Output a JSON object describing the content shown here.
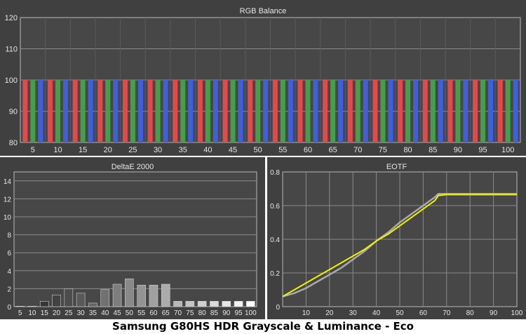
{
  "caption": "Samsung G80HS HDR Grayscale & Luminance - Eco",
  "colors": {
    "panel_bg": "#404040",
    "plot_bg": "#474747",
    "grid": "#8a8a8a",
    "text": "#e6e6e6",
    "red": "#e8474a",
    "green": "#43a048",
    "blue": "#3f5ee0",
    "target": "#a9a9a9",
    "measured": "#f2f200"
  },
  "chart_data": [
    {
      "id": "rgb",
      "type": "bar",
      "title": "RGB Balance",
      "ylim": [
        80,
        120
      ],
      "yticks": [
        80,
        90,
        100,
        110,
        120
      ],
      "categories": [
        "5",
        "10",
        "15",
        "20",
        "25",
        "30",
        "35",
        "40",
        "45",
        "50",
        "55",
        "60",
        "65",
        "70",
        "75",
        "80",
        "85",
        "90",
        "95",
        "100"
      ],
      "series": [
        {
          "color": "red",
          "values": [
            100,
            100,
            100,
            100,
            100,
            100,
            100,
            100,
            100,
            100,
            100,
            100,
            100,
            100,
            100,
            100,
            100,
            100,
            100,
            100
          ]
        },
        {
          "color": "green",
          "values": [
            100,
            100,
            100,
            100,
            100,
            100,
            100,
            100,
            100,
            100,
            100,
            100,
            100,
            100,
            100,
            100,
            100,
            100,
            100,
            100
          ]
        },
        {
          "color": "blue",
          "values": [
            100,
            100,
            100,
            100,
            100,
            100,
            100,
            100,
            100,
            100,
            100,
            100,
            100,
            100,
            100,
            100,
            100,
            100,
            100,
            100
          ]
        }
      ],
      "grid": true
    },
    {
      "id": "deltae",
      "type": "bar",
      "title": "DeltaE 2000",
      "ylim": [
        0,
        15
      ],
      "yticks": [
        0,
        2,
        4,
        6,
        8,
        10,
        12,
        14
      ],
      "categories": [
        "5",
        "10",
        "15",
        "20",
        "25",
        "30",
        "35",
        "40",
        "45",
        "50",
        "55",
        "60",
        "65",
        "70",
        "75",
        "80",
        "85",
        "90",
        "95",
        "100"
      ],
      "values": [
        0.05,
        0.05,
        0.6,
        1.3,
        2.0,
        1.5,
        0.4,
        1.9,
        2.5,
        3.1,
        2.4,
        2.4,
        2.5,
        0.6,
        0.6,
        0.6,
        0.6,
        0.6,
        0.6,
        0.6
      ],
      "grid": true
    },
    {
      "id": "eotf",
      "type": "line",
      "title": "EOTF",
      "xlim": [
        0,
        100
      ],
      "ylim": [
        0,
        0.8
      ],
      "xticks": [
        10,
        20,
        30,
        40,
        50,
        60,
        70,
        80,
        90,
        100
      ],
      "yticks": [
        0,
        0.2,
        0.4,
        0.6,
        0.8
      ],
      "series": [
        {
          "color": "target",
          "x": [
            0,
            5,
            10,
            15,
            20,
            25,
            30,
            35,
            40,
            45,
            50,
            55,
            60,
            65,
            66.5,
            70,
            80,
            90,
            100
          ],
          "y": [
            0.06,
            0.08,
            0.11,
            0.15,
            0.19,
            0.23,
            0.28,
            0.33,
            0.39,
            0.44,
            0.5,
            0.55,
            0.6,
            0.65,
            0.67,
            0.67,
            0.67,
            0.67,
            0.67
          ]
        },
        {
          "color": "measured",
          "x": [
            0,
            5,
            10,
            15,
            20,
            25,
            30,
            35,
            40,
            45,
            50,
            55,
            60,
            65,
            66.5,
            70,
            80,
            90,
            100
          ],
          "y": [
            0.06,
            0.1,
            0.14,
            0.18,
            0.22,
            0.26,
            0.3,
            0.34,
            0.39,
            0.43,
            0.48,
            0.53,
            0.58,
            0.63,
            0.66,
            0.665,
            0.665,
            0.665,
            0.665
          ]
        }
      ],
      "grid": true
    }
  ]
}
